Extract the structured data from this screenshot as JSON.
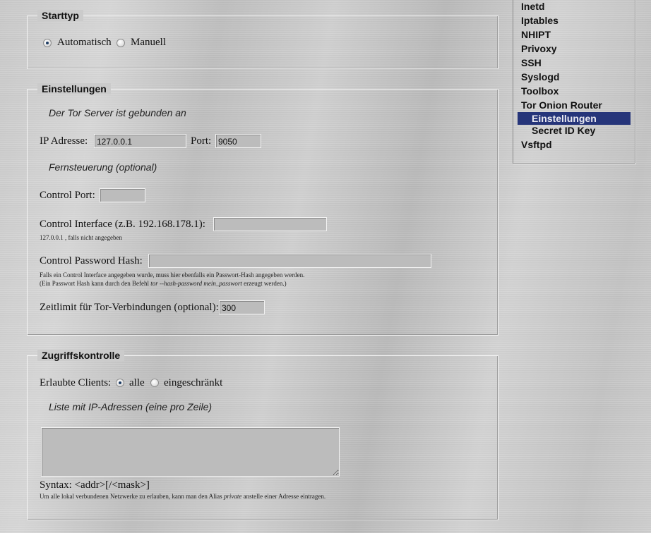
{
  "starttyp": {
    "legend": "Starttyp",
    "options": [
      {
        "label": "Automatisch",
        "selected": true
      },
      {
        "label": "Manuell",
        "selected": false
      }
    ]
  },
  "einstellungen": {
    "legend": "Einstellungen",
    "bound_heading": "Der Tor Server ist gebunden an",
    "ip_label": "IP Adresse:",
    "ip_value": "127.0.0.1",
    "port_label": "Port:",
    "port_value": "9050",
    "remote_heading": "Fernsteuerung (optional)",
    "control_port_label": "Control Port:",
    "control_port_value": "",
    "control_interface_label": "Control Interface (z.B. 192.168.178.1):",
    "control_interface_value": "",
    "control_interface_hint": "127.0.0.1 , falls nicht angegeben",
    "password_hash_label": "Control Password Hash:",
    "password_hash_value": "",
    "hash_hint_1": "Falls ein Control Interface angegeben wurde, muss hier ebenfalls ein Passwort-Hash angegeben werden.",
    "hash_hint_2_pre": "(Ein Passwort Hash kann durch den Befehl ",
    "hash_hint_2_cmd": "tor --hash-password mein_passwort",
    "hash_hint_2_post": " erzeugt werden.)",
    "timeout_label": "Zeitlimit für Tor-Verbindungen (optional):",
    "timeout_value": "300"
  },
  "zugriff": {
    "legend": "Zugriffskontrolle",
    "clients_label": "Erlaubte Clients:",
    "options": [
      {
        "label": "alle",
        "selected": true
      },
      {
        "label": "eingeschränkt",
        "selected": false
      }
    ],
    "list_heading": "Liste mit IP-Adressen (eine pro Zeile)",
    "list_value": "",
    "syntax": "Syntax: <addr>[/<mask>]",
    "hint_pre": "Um alle lokal verbundenen Netzwerke zu erlauben, kann man den Alias ",
    "hint_alias": "private",
    "hint_post": " anstelle einer Adresse eintragen."
  },
  "sidebar": {
    "items": [
      {
        "label": "Inetd"
      },
      {
        "label": "Iptables"
      },
      {
        "label": "NHIPT"
      },
      {
        "label": "Privoxy"
      },
      {
        "label": "SSH"
      },
      {
        "label": "Syslogd"
      },
      {
        "label": "Toolbox"
      },
      {
        "label": "Tor Onion Router"
      },
      {
        "label": "Einstellungen",
        "selected": true
      },
      {
        "label": "Secret ID Key"
      },
      {
        "label": "Vsftpd"
      }
    ],
    "selected_color": "#26357a"
  }
}
